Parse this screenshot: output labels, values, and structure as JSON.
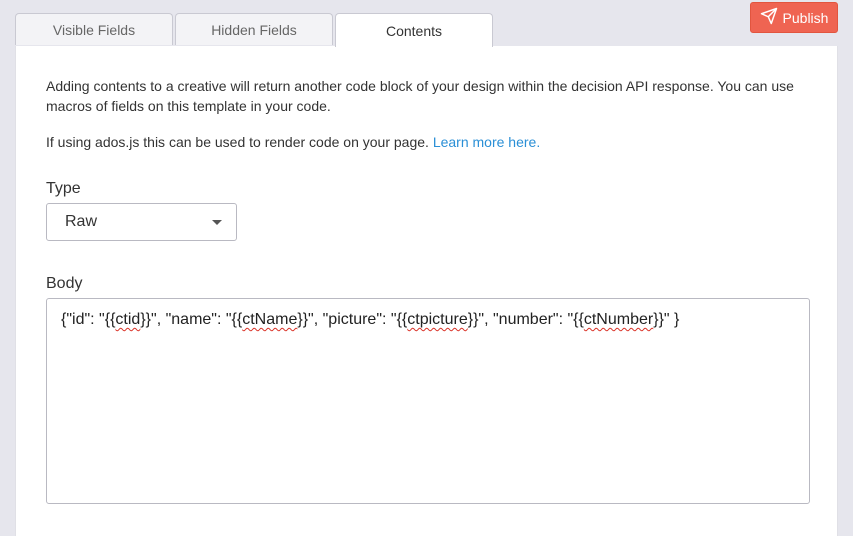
{
  "tabs": [
    {
      "label": "Visible Fields"
    },
    {
      "label": "Hidden Fields"
    },
    {
      "label": "Contents"
    }
  ],
  "publish_label": "Publish",
  "description": "Adding contents to a creative will return another code block of your design within the decision API response. You can use macros of fields on this template in your code.",
  "adosjs_text": "If using ados.js this can be used to render code on your page.",
  "learn_more": "Learn more here.",
  "type_label": "Type",
  "type_value": "Raw",
  "body_label": "Body",
  "body_parts": [
    "{\"id\": \"{{",
    "ctid",
    "}}\", \"name\": \"{{",
    "ctName",
    "}}\", \"picture\": \"{{",
    "ctpicture",
    "}}\", \"number\": \"{{",
    "ctNumber",
    "}}\" }"
  ],
  "colors": {
    "accent": "#ef6452",
    "link": "#2a8fd6",
    "background": "#e6e6ed"
  },
  "icons": {
    "publish": "paper-plane-icon",
    "dropdown": "caret-down-icon"
  }
}
